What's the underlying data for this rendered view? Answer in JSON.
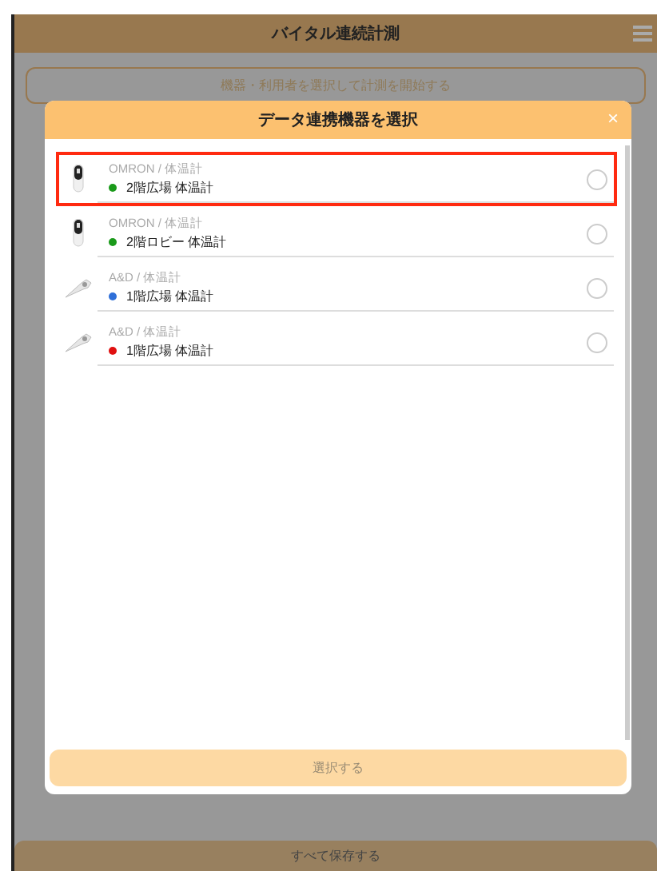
{
  "header": {
    "title": "バイタル連続計測"
  },
  "start_button": {
    "label": "機器・利用者を選択して計測を開始する"
  },
  "dialog": {
    "title": "データ連携機器を選択",
    "close": "×",
    "devices": [
      {
        "kind": "handheld",
        "maker": "OMRON / 体温計",
        "name": "2階広場 体温計",
        "color": "#1a9a1a",
        "highlighted": true,
        "selected": false
      },
      {
        "kind": "handheld",
        "maker": "OMRON / 体温計",
        "name": "2階ロビー 体温計",
        "color": "#1a9a1a",
        "highlighted": false,
        "selected": false
      },
      {
        "kind": "stick",
        "maker": "A&D / 体温計",
        "name": "1階広場 体温計",
        "color": "#2f6fd8",
        "highlighted": false,
        "selected": false
      },
      {
        "kind": "stick",
        "maker": "A&D / 体温計",
        "name": "1階広場 体温計",
        "color": "#e01010",
        "highlighted": false,
        "selected": false
      }
    ],
    "confirm": {
      "label": "選択する"
    }
  },
  "footer": {
    "label": "すべて保存する"
  }
}
